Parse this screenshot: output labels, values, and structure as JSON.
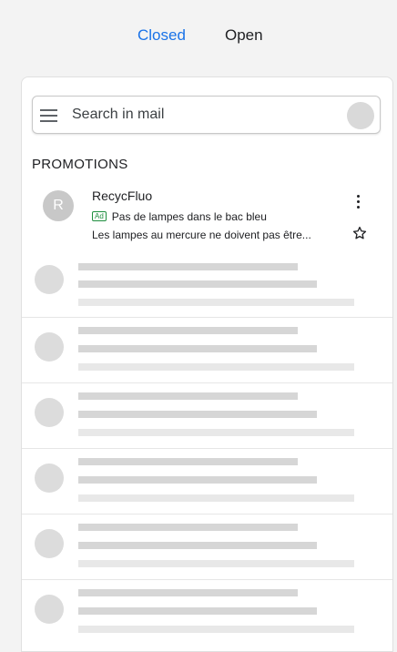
{
  "tabs": {
    "closed": "Closed",
    "open": "Open",
    "active_color": "#1a73e8"
  },
  "search": {
    "placeholder": "Search in mail",
    "menu_icon": "hamburger-menu-icon"
  },
  "section": {
    "title": "PROMOTIONS"
  },
  "email": {
    "avatar_letter": "R",
    "sender": "RecycFluo",
    "ad_badge": "Ad",
    "subject": "Pas de lampes dans le bac bleu",
    "snippet": "Les lampes au mercure ne doivent pas être...",
    "more_icon": "more-vertical-icon",
    "star_icon": "star-outline-icon"
  },
  "colors": {
    "accent": "#1a73e8",
    "ad_green": "#1e8e3e",
    "placeholder_gray": "#d6d6d6"
  }
}
